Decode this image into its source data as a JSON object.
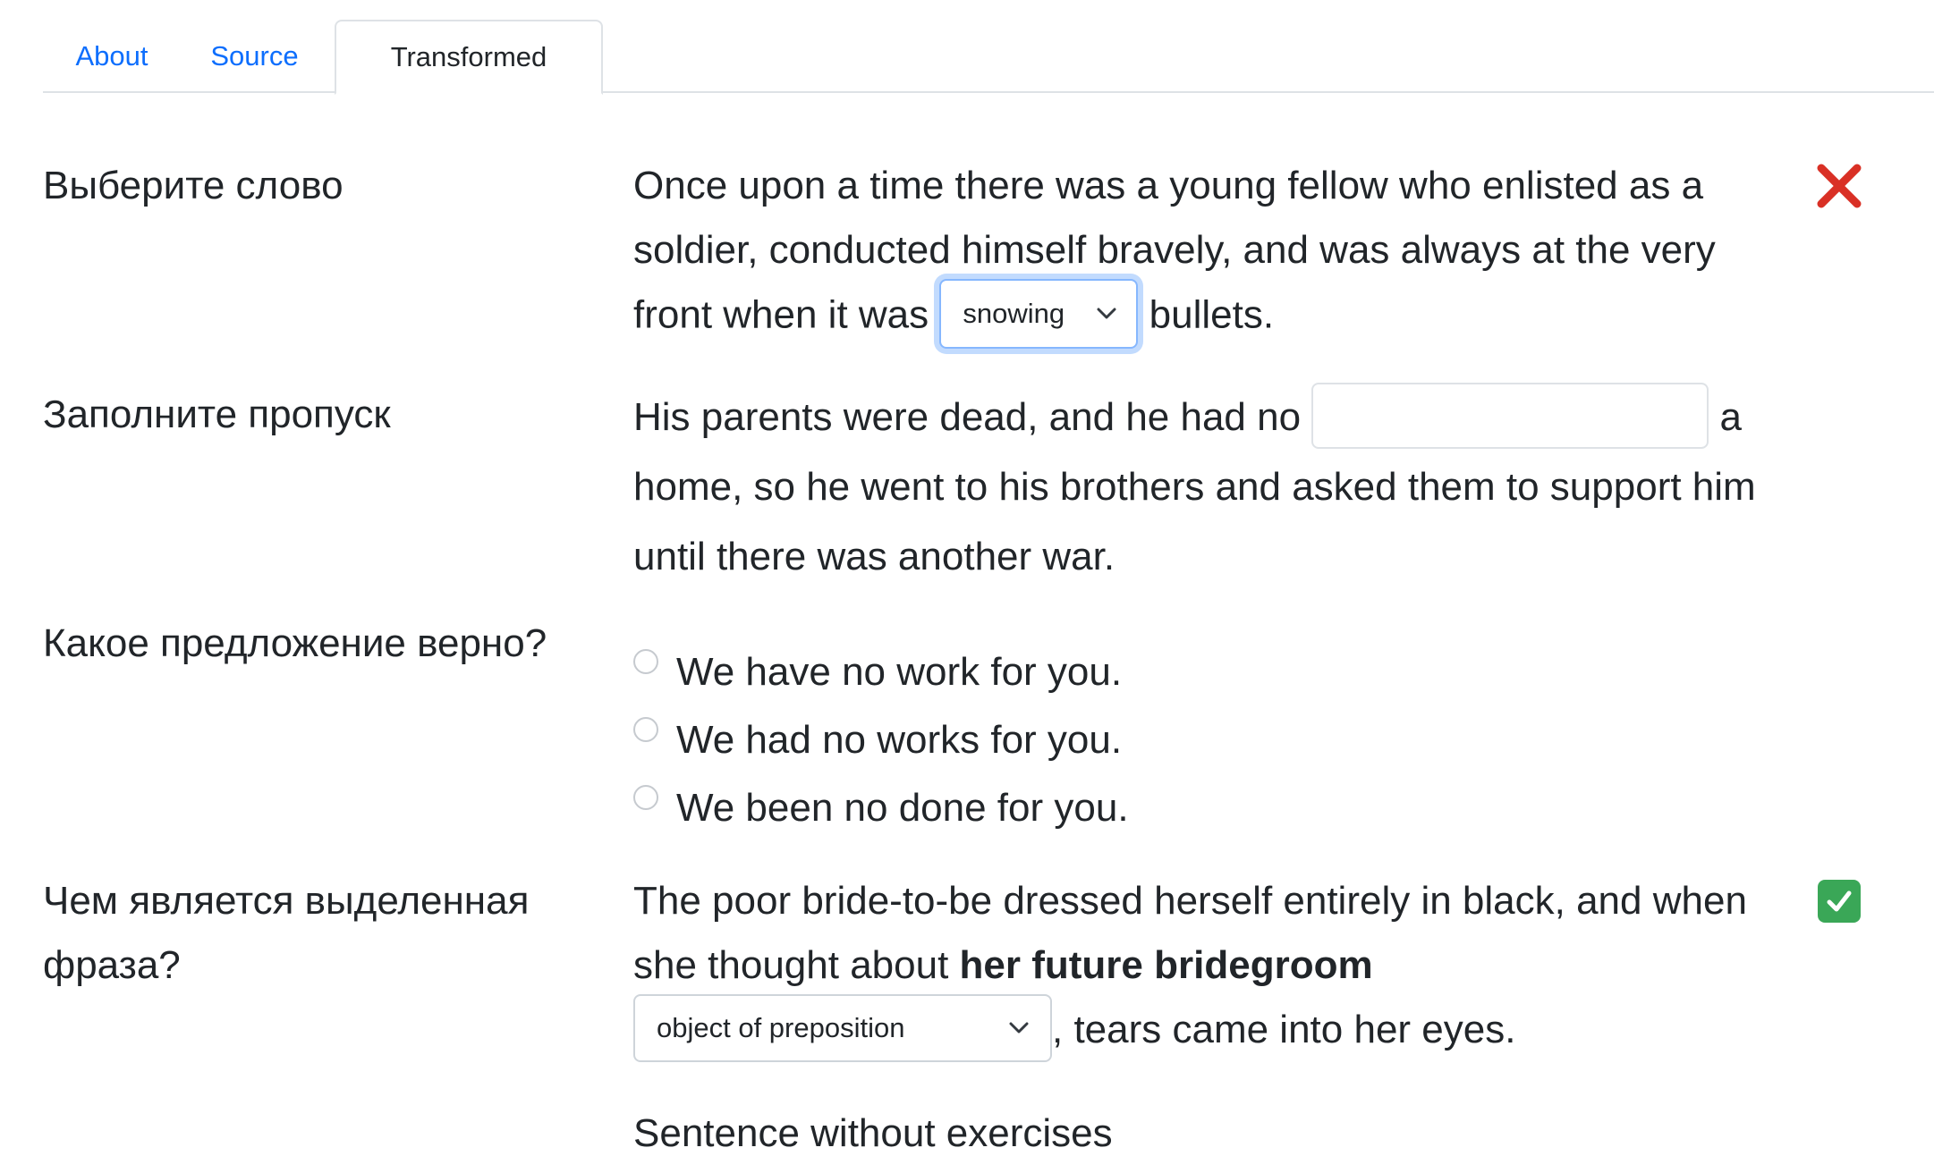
{
  "tabs": [
    {
      "label": "About"
    },
    {
      "label": "Source"
    },
    {
      "label": "Transformed"
    }
  ],
  "exercises": {
    "choose_word": {
      "label": "Выберите слово",
      "text_before": "Once upon a time there was a young fellow who enlisted as a soldier, conducted himself bravely, and was always at the very front when it was",
      "selected": "snowing",
      "text_after": "bullets.",
      "status_icon": "cross-icon",
      "status_color": "#d93025"
    },
    "fill_blank": {
      "label": "Заполните пропуск",
      "text_before": "His parents were dead, and he had no",
      "input_value": "",
      "text_after": "a home, so he went to his brothers and asked them to support him until there was another war."
    },
    "correct_sentence": {
      "label": "Какое предложение верно?",
      "options": [
        "We have no work for you.",
        "We had no works for you.",
        "We been no done for you."
      ]
    },
    "highlighted_phrase": {
      "label": "Чем является выделенная фраза?",
      "text_before": "The poor bride-to-be dressed herself entirely in black, and when she thought about",
      "bold_phrase": "her future bridegroom",
      "selected": "object of preposition",
      "text_after": ", tears came into her eyes.",
      "status_icon": "check-mark-icon",
      "status_color": "#3aa757"
    }
  },
  "footer_heading": "Sentence without exercises"
}
